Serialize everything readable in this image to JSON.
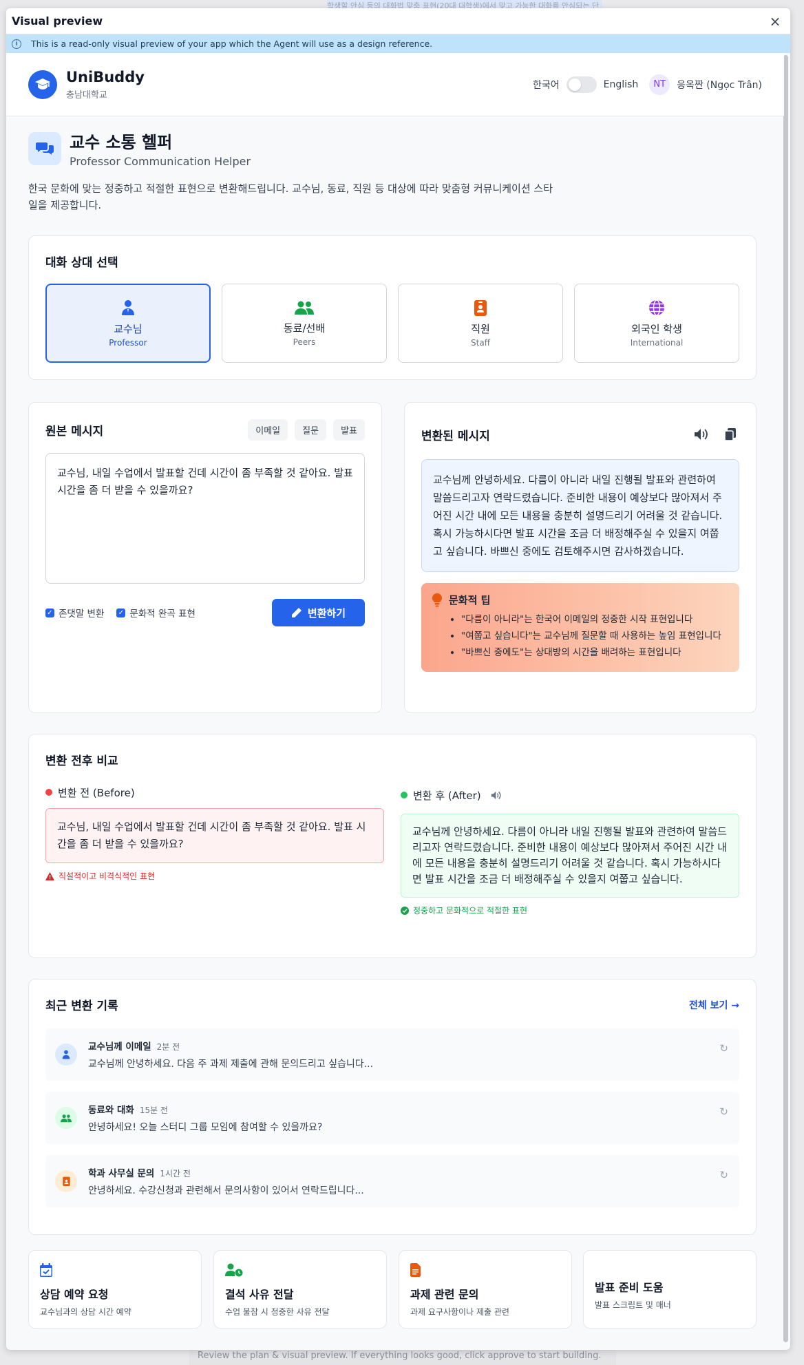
{
  "background": {
    "top_text": "학생할 안심 등의 대화법 맞춤 표현(20대 대학생)에서 맞고 가능한 대화를 안심되는 단",
    "bottom_text": "Review the plan & visual preview. If everything looks good, click approve to start building."
  },
  "modal": {
    "title": "Visual preview",
    "close": "×",
    "notice": "This is a read-only visual preview of your app which the Agent will use as a design reference."
  },
  "header": {
    "brand": "UniBuddy",
    "university": "충남대학교",
    "lang_ko": "한국어",
    "lang_en": "English",
    "user_initials": "NT",
    "user_name": "응옥짠 (Ngọc Trân)"
  },
  "page": {
    "title": "교수 소통 헬퍼",
    "subtitle": "Professor Communication Helper",
    "description": "한국 문화에 맞는 정중하고 적절한 표현으로 변환해드립니다. 교수님, 동료, 직원 등 대상에 따라 맞춤형 커뮤니케이션 스타일을 제공합니다."
  },
  "recipient": {
    "title": "대화 상대 선택",
    "options": [
      {
        "label": "교수님",
        "sub": "Professor",
        "icon": "professor-icon",
        "color": "#2563eb",
        "active": true
      },
      {
        "label": "동료/선배",
        "sub": "Peers",
        "icon": "peers-icon",
        "color": "#16a34a",
        "active": false
      },
      {
        "label": "직원",
        "sub": "Staff",
        "icon": "staff-badge-icon",
        "color": "#ea580c",
        "active": false
      },
      {
        "label": "외국인 학생",
        "sub": "International",
        "icon": "globe-icon",
        "color": "#9333ea",
        "active": false
      }
    ]
  },
  "original": {
    "title": "원본 메시지",
    "chips": [
      "이메일",
      "질문",
      "발표"
    ],
    "text": "교수님, 내일 수업에서 발표할 건데 시간이 좀 부족할 것 같아요. 발표 시간을 좀 더 받을 수 있을까요?",
    "check1": "존댓말 변환",
    "check2": "문화적 완곡 표현",
    "convert": "변환하기"
  },
  "converted": {
    "title": "변환된 메시지",
    "text": "교수님께 안녕하세요. 다름이 아니라 내일 진행될 발표와 관련하여 말씀드리고자 연락드렸습니다. 준비한 내용이 예상보다 많아져서 주어진 시간 내에 모든 내용을 충분히 설명드리기 어려울 것 같습니다. 혹시 가능하시다면 발표 시간을 조금 더 배정해주실 수 있을지 여쭙고 싶습니다. 바쁘신 중에도 검토해주시면 감사하겠습니다.",
    "tip_title": "문화적 팁",
    "tips": [
      "\"다름이 아니라\"는 한국어 이메일의 정중한 시작 표현입니다",
      "\"여쭙고 싶습니다\"는 교수님께 질문할 때 사용하는 높임 표현입니다",
      "\"바쁘신 중에도\"는 상대방의 시간을 배려하는 표현입니다"
    ]
  },
  "compare": {
    "title": "변환 전후 비교",
    "before_label": "변환 전 (Before)",
    "before_text": "교수님, 내일 수업에서 발표할 건데 시간이 좀 부족할 것 같아요. 발표 시간을 좀 더 받을 수 있을까요?",
    "before_note": "직설적이고 비격식적인 표현",
    "after_label": "변환 후 (After)",
    "after_text": "교수님께 안녕하세요. 다름이 아니라 내일 진행될 발표와 관련하여 말씀드리고자 연락드렸습니다. 준비한 내용이 예상보다 많아져서 주어진 시간 내에 모든 내용을 충분히 설명드리기 어려울 것 같습니다. 혹시 가능하시다면 발표 시간을 조금 더 배정해주실 수 있을지 여쭙고 싶습니다.",
    "after_note": "정중하고 문화적으로 적절한 표현"
  },
  "history": {
    "title": "최근 변환 기록",
    "view_all": "전체 보기 →",
    "items": [
      {
        "title": "교수님께 이메일",
        "time": "2분 전",
        "text": "교수님께 안녕하세요. 다음 주 과제 제출에 관해 문의드리고 싶습니다...",
        "icon": "professor-icon",
        "bg": "#dbeafe",
        "color": "#2563eb"
      },
      {
        "title": "동료와 대화",
        "time": "15분 전",
        "text": "안녕하세요! 오늘 스터디 그룹 모임에 참여할 수 있을까요?",
        "icon": "peers-icon",
        "bg": "#dcfce7",
        "color": "#16a34a"
      },
      {
        "title": "학과 사무실 문의",
        "time": "1시간 전",
        "text": "안녕하세요. 수강신청과 관련해서 문의사항이 있어서 연락드립니다...",
        "icon": "staff-badge-icon",
        "bg": "#ffedd5",
        "color": "#ea580c"
      }
    ]
  },
  "quick_actions": [
    {
      "title": "상담 예약 요청",
      "sub": "교수님과의 상담 시간 예약",
      "icon": "calendar-check-icon",
      "color": "#2563eb"
    },
    {
      "title": "결석 사유 전달",
      "sub": "수업 불참 시 정중한 사유 전달",
      "icon": "user-clock-icon",
      "color": "#16a34a"
    },
    {
      "title": "과제 관련 문의",
      "sub": "과제 요구사항이나 제출 관련",
      "icon": "file-icon",
      "color": "#ea580c"
    },
    {
      "title": "발표 준비 도움",
      "sub": "발표 스크립트 및 매너",
      "icon": "",
      "color": ""
    }
  ]
}
